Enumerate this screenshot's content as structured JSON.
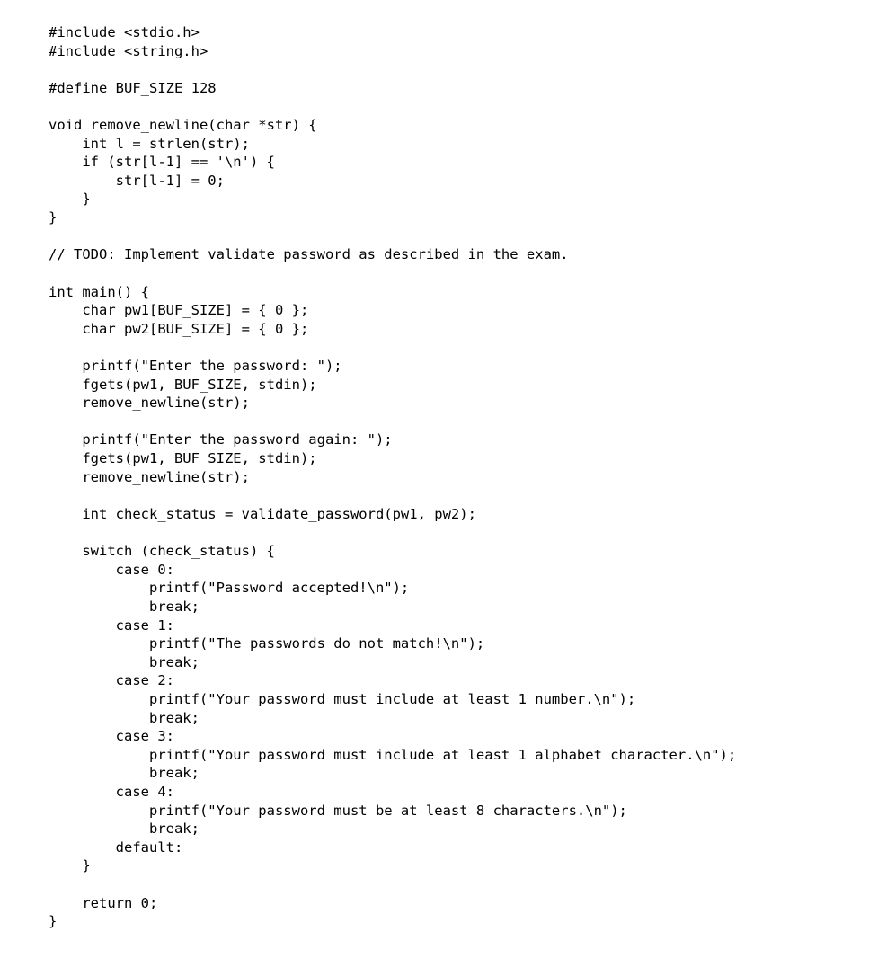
{
  "code_lines": [
    "#include <stdio.h>",
    "#include <string.h>",
    "",
    "#define BUF_SIZE 128",
    "",
    "void remove_newline(char *str) {",
    "    int l = strlen(str);",
    "    if (str[l-1] == '\\n') {",
    "        str[l-1] = 0;",
    "    }",
    "}",
    "",
    "// TODO: Implement validate_password as described in the exam.",
    "",
    "int main() {",
    "    char pw1[BUF_SIZE] = { 0 };",
    "    char pw2[BUF_SIZE] = { 0 };",
    "",
    "    printf(\"Enter the password: \");",
    "    fgets(pw1, BUF_SIZE, stdin);",
    "    remove_newline(str);",
    "",
    "    printf(\"Enter the password again: \");",
    "    fgets(pw1, BUF_SIZE, stdin);",
    "    remove_newline(str);",
    "",
    "    int check_status = validate_password(pw1, pw2);",
    "",
    "    switch (check_status) {",
    "        case 0:",
    "            printf(\"Password accepted!\\n\");",
    "            break;",
    "        case 1:",
    "            printf(\"The passwords do not match!\\n\");",
    "            break;",
    "        case 2:",
    "            printf(\"Your password must include at least 1 number.\\n\");",
    "            break;",
    "        case 3:",
    "            printf(\"Your password must include at least 1 alphabet character.\\n\");",
    "            break;",
    "        case 4:",
    "            printf(\"Your password must be at least 8 characters.\\n\");",
    "            break;",
    "        default:",
    "    }",
    "",
    "    return 0;",
    "}"
  ]
}
